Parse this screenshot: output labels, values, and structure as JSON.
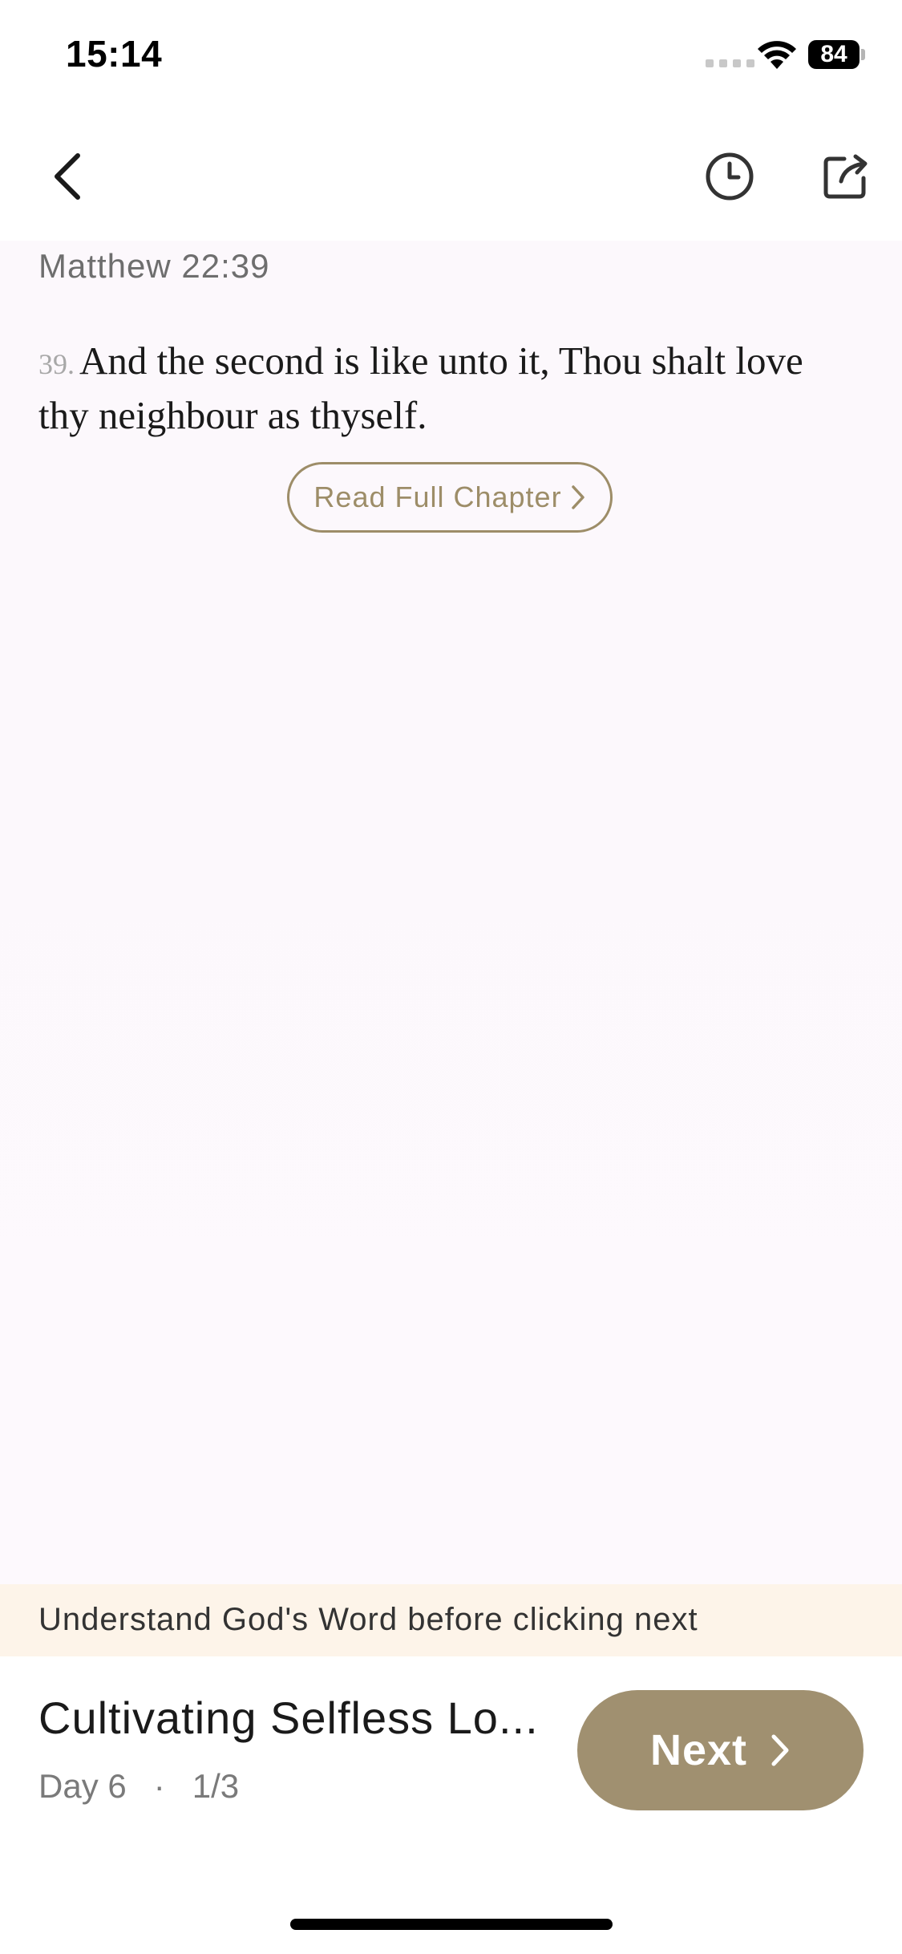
{
  "status_bar": {
    "time": "15:14",
    "battery": "84"
  },
  "nav": {
    "back_icon": "chevron-left-icon",
    "history_icon": "clock-icon",
    "share_icon": "share-icon"
  },
  "verse": {
    "reference": "Matthew 22:39",
    "number": "39.",
    "text": "And the second is like unto it, Thou shalt love thy neighbour as thyself."
  },
  "read_chapter": {
    "label": "Read Full Chapter"
  },
  "hint": {
    "text": "Understand God's Word before clicking next"
  },
  "plan": {
    "title": "Cultivating Selfless Lo...",
    "day": "Day 6",
    "separator": "·",
    "progress": "1/3"
  },
  "next_button": {
    "label": "Next"
  },
  "colors": {
    "accent": "#a09070",
    "outline_accent": "#9d8d68",
    "hint_background": "#fdf4e9",
    "content_background": "#fcf8fc"
  }
}
